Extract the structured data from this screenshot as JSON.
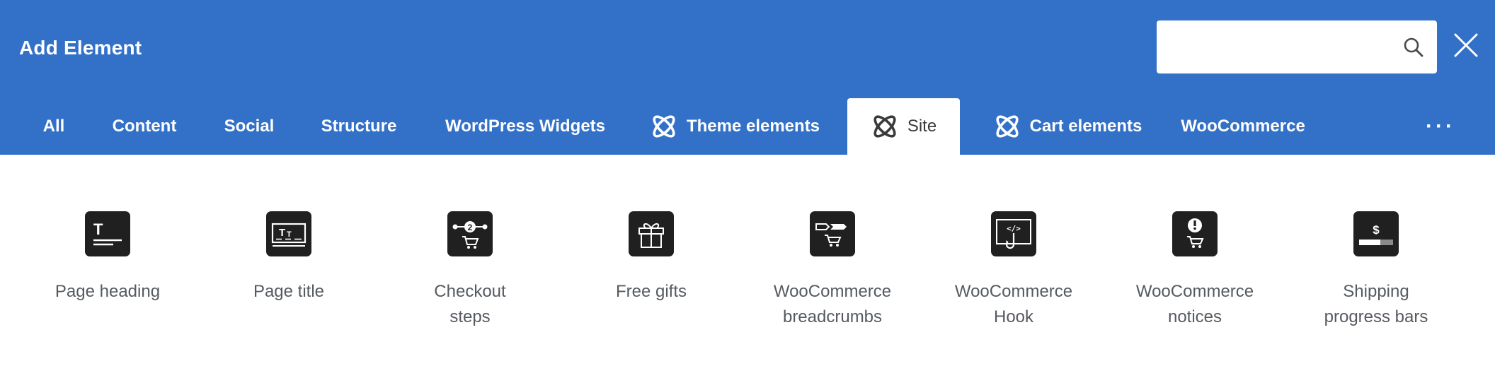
{
  "header": {
    "title": "Add Element",
    "search": {
      "value": "",
      "placeholder": ""
    },
    "colors": {
      "background": "#3371c8",
      "text": "#ffffff"
    }
  },
  "tabs": [
    {
      "label": "All",
      "active": false,
      "icon": null
    },
    {
      "label": "Content",
      "active": false,
      "icon": null
    },
    {
      "label": "Social",
      "active": false,
      "icon": null
    },
    {
      "label": "Structure",
      "active": false,
      "icon": null
    },
    {
      "label": "WordPress Widgets",
      "active": false,
      "icon": null
    },
    {
      "label": "Theme elements",
      "active": false,
      "icon": "atom-icon"
    },
    {
      "label": "Site",
      "active": true,
      "icon": "atom-icon"
    },
    {
      "label": "Cart elements",
      "active": false,
      "icon": "atom-icon"
    },
    {
      "label": "WooCommerce",
      "active": false,
      "icon": null
    }
  ],
  "more_tabs": "···",
  "elements": [
    {
      "label": "Page heading",
      "icon": "page-heading-icon"
    },
    {
      "label": "Page title",
      "icon": "page-title-icon"
    },
    {
      "label": "Checkout\nsteps",
      "icon": "checkout-steps-icon"
    },
    {
      "label": "Free gifts",
      "icon": "gift-icon"
    },
    {
      "label": "WooCommerce\nbreadcrumbs",
      "icon": "breadcrumbs-cart-icon"
    },
    {
      "label": "WooCommerce\nHook",
      "icon": "hook-icon"
    },
    {
      "label": "WooCommerce\nnotices",
      "icon": "notice-cart-icon"
    },
    {
      "label": "Shipping\nprogress bars",
      "icon": "shipping-progress-icon"
    }
  ]
}
